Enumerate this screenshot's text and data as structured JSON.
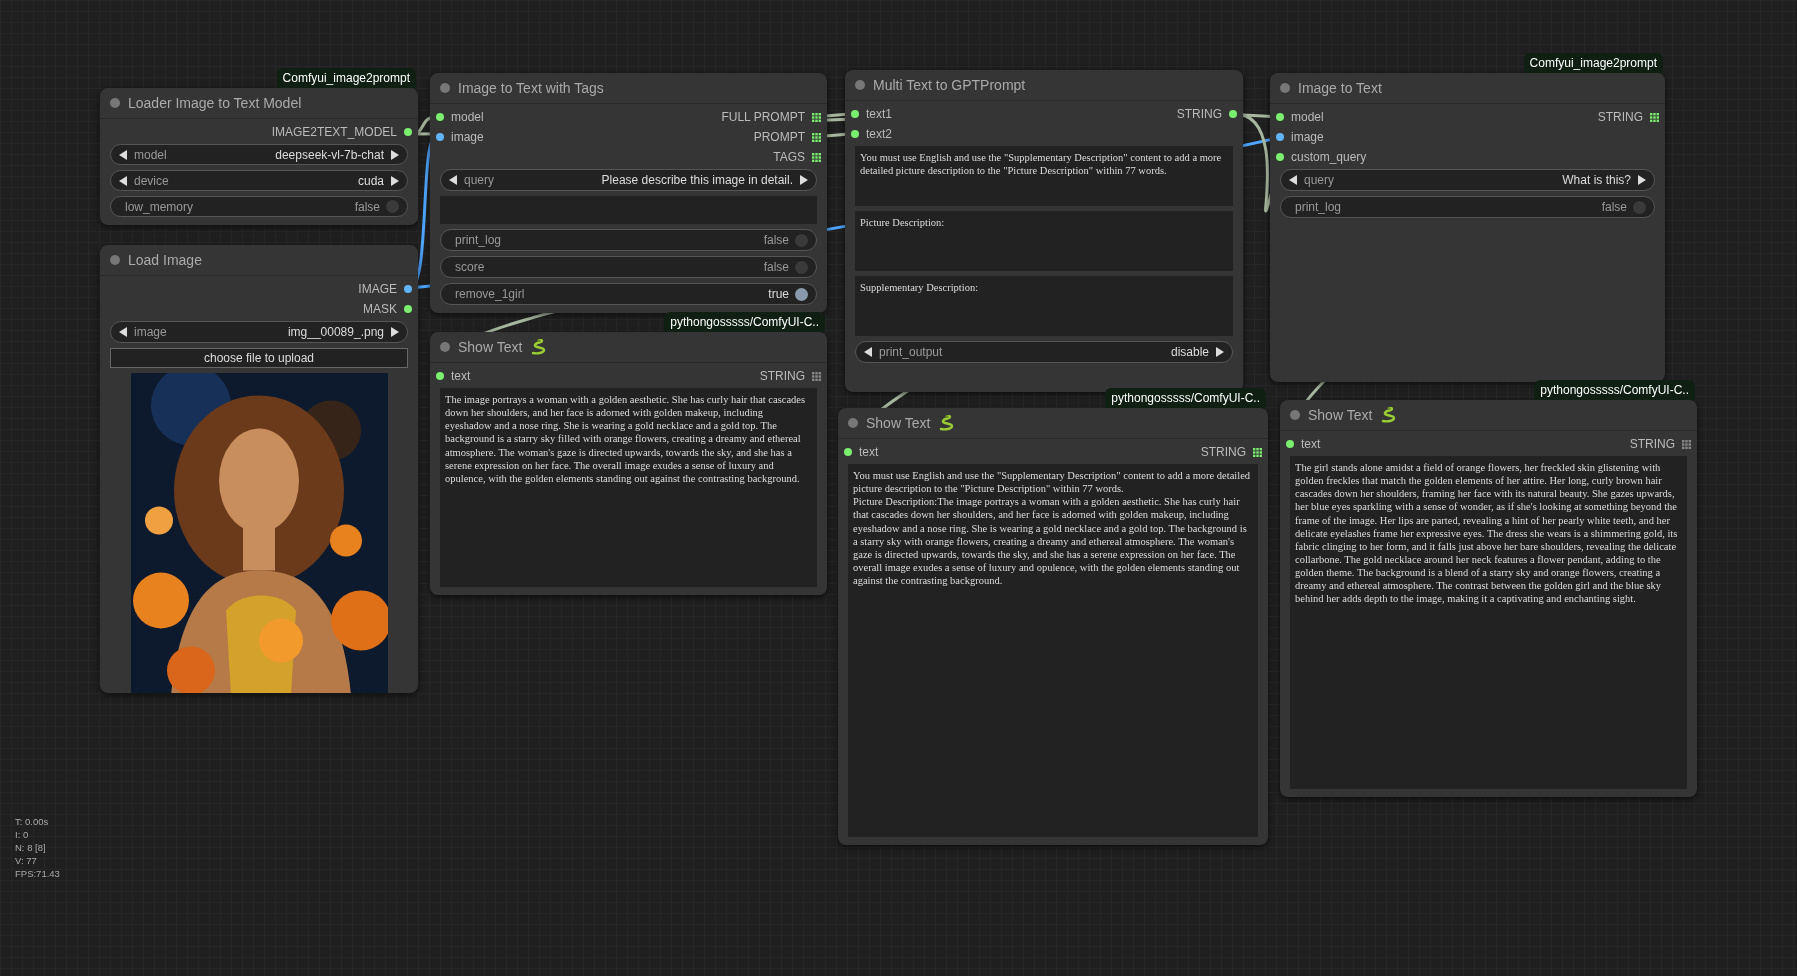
{
  "canvas": {
    "nodes": [
      {
        "title": "Loader Image to Text Model",
        "badge": "Comfyui_image2prompt",
        "outputs": [
          {
            "label": "IMAGE2TEXT_MODEL",
            "color": "#7bee6f",
            "kind": "dot"
          }
        ],
        "widgets": [
          {
            "kind": "combo",
            "label": "model",
            "value": "deepseek-vl-7b-chat"
          },
          {
            "kind": "combo",
            "label": "device",
            "value": "cuda"
          },
          {
            "kind": "toggle",
            "label": "low_memory",
            "value": "false",
            "on": false
          }
        ]
      },
      {
        "title": "Load Image",
        "outputs": [
          {
            "label": "IMAGE",
            "color": "#64b5f6",
            "kind": "dot"
          },
          {
            "label": "MASK",
            "color": "#7bee6f",
            "kind": "dot"
          }
        ],
        "widgets": [
          {
            "kind": "combo",
            "label": "image",
            "value": "img__00089_.png"
          },
          {
            "kind": "button",
            "label": "choose file to upload"
          },
          {
            "kind": "picture"
          }
        ]
      },
      {
        "title": "Image to Text with Tags",
        "inputs": [
          {
            "label": "model",
            "color": "#7bee6f"
          },
          {
            "label": "image",
            "color": "#64b5f6"
          }
        ],
        "outputs": [
          {
            "label": "FULL PROMPT",
            "color": "#7bee6f",
            "kind": "grid"
          },
          {
            "label": "PROMPT",
            "color": "#7bee6f",
            "kind": "grid"
          },
          {
            "label": "TAGS",
            "color": "#7bee6f",
            "kind": "grid"
          }
        ],
        "widgets": [
          {
            "kind": "combo",
            "label": "query",
            "value": "Please describe this image in detail."
          },
          {
            "kind": "text"
          },
          {
            "kind": "toggle",
            "label": "print_log",
            "value": "false",
            "on": false
          },
          {
            "kind": "toggle",
            "label": "score",
            "value": "false",
            "on": false
          },
          {
            "kind": "toggle",
            "label": "remove_1girl",
            "value": "true",
            "on": true
          }
        ]
      },
      {
        "title": "Show Text",
        "badge": "pythongosssss/ComfyUI-C..",
        "inputs": [
          {
            "label": "text",
            "color": "#7bee6f"
          }
        ],
        "outputs": [
          {
            "label": "STRING",
            "color": "#888888",
            "kind": "grid"
          }
        ],
        "widgets": [
          {
            "kind": "text",
            "value": "The image portrays a woman with a golden aesthetic. She has curly hair that cascades down her shoulders, and her face is adorned with golden makeup, including eyeshadow and a nose ring. She is wearing a gold necklace and a gold top. The background is a starry sky filled with orange flowers, creating a dreamy and ethereal atmosphere. The woman's gaze is directed upwards, towards the sky, and she has a serene expression on her face. The overall image exudes a sense of luxury and opulence, with the golden elements standing out against the contrasting background."
          }
        ]
      },
      {
        "title": "Multi Text to GPTPrompt",
        "inputs": [
          {
            "label": "text1",
            "color": "#7bee6f"
          },
          {
            "label": "text2",
            "color": "#7bee6f"
          }
        ],
        "outputs": [
          {
            "label": "STRING",
            "color": "#7bee6f",
            "kind": "dot"
          }
        ],
        "widgets": [
          {
            "kind": "text",
            "value": "You must use English and use the \"Supplementary Description\" content to add a more detailed picture description to the \"Picture Description\" within 77 words."
          },
          {
            "kind": "text",
            "value": "Picture Description:"
          },
          {
            "kind": "text",
            "value": "Supplementary Description:"
          },
          {
            "kind": "combo",
            "label": "print_output",
            "value": "disable"
          }
        ]
      },
      {
        "title": "Show Text",
        "badge": "pythongosssss/ComfyUI-C..",
        "inputs": [
          {
            "label": "text",
            "color": "#7bee6f"
          }
        ],
        "outputs": [
          {
            "label": "STRING",
            "color": "#7bee6f",
            "kind": "grid"
          }
        ],
        "widgets": [
          {
            "kind": "text",
            "value": "You must use English and use the \"Supplementary Description\" content to add a more detailed picture description to the \"Picture Description\" within 77 words.\nPicture Description:The image portrays a woman with a golden aesthetic. She has curly hair that cascades down her shoulders, and her face is adorned with golden makeup, including eyeshadow and a nose ring. She is wearing a gold necklace and a gold top. The background is a starry sky with orange flowers, creating a dreamy and ethereal atmosphere. The woman's gaze is directed upwards, towards the sky, and she has a serene expression on her face. The overall image exudes a sense of luxury and opulence, with the golden elements standing out against the contrasting background."
          }
        ]
      },
      {
        "title": "Image to Text",
        "badge": "Comfyui_image2prompt",
        "inputs": [
          {
            "label": "model",
            "color": "#7bee6f"
          },
          {
            "label": "image",
            "color": "#64b5f6"
          },
          {
            "label": "custom_query",
            "color": "#7bee6f"
          }
        ],
        "outputs": [
          {
            "label": "STRING",
            "color": "#7bee6f",
            "kind": "grid"
          }
        ],
        "widgets": [
          {
            "kind": "combo",
            "label": "query",
            "value": "What is this?"
          },
          {
            "kind": "toggle",
            "label": "print_log",
            "value": "false",
            "on": false
          }
        ]
      },
      {
        "title": "Show Text",
        "badge": "pythongosssss/ComfyUI-C..",
        "inputs": [
          {
            "label": "text",
            "color": "#7bee6f"
          }
        ],
        "outputs": [
          {
            "label": "STRING",
            "color": "#888888",
            "kind": "grid"
          }
        ],
        "widgets": [
          {
            "kind": "text",
            "value": "The girl stands alone amidst a field of orange flowers, her freckled skin glistening with golden freckles that match the golden elements of her attire. Her long, curly brown hair cascades down her shoulders, framing her face with its natural beauty. She gazes upwards, her blue eyes sparkling with a sense of wonder, as if she's looking at something beyond the frame of the image. Her lips are parted, revealing a hint of her pearly white teeth, and her delicate eyelashes frame her expressive eyes. The dress she wears is a shimmering gold, its fabric clinging to her form, and it falls just above her bare shoulders, revealing the delicate collarbone. The gold necklace around her neck features a flower pendant, adding to the golden theme. The background is a blend of a starry sky and orange flowers, creating a dreamy and ethereal atmosphere. The contrast between the golden girl and the blue sky behind her adds depth to the image, making it a captivating and enchanting sight."
          }
        ]
      }
    ],
    "stats": [
      "T: 0.00s",
      "I: 0",
      "N: 8 [8]",
      "V: 77",
      "FPS:71.43"
    ]
  }
}
